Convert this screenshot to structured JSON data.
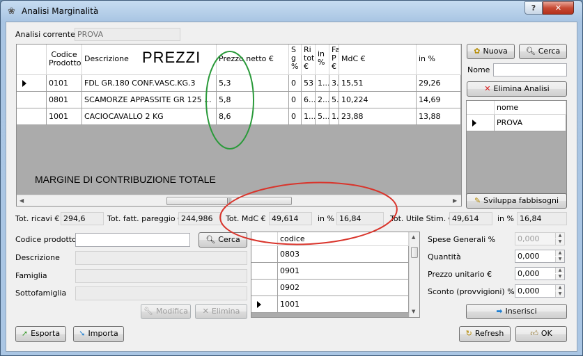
{
  "window": {
    "title": "Analisi Marginalità",
    "help_label": "?",
    "close_label": "✕"
  },
  "current": {
    "label": "Analisi corrente",
    "value": "PROVA"
  },
  "prices_grid": {
    "overlay_title": "PREZZI",
    "columns": [
      {
        "label": "Codice Prodotto"
      },
      {
        "label": "Descrizione"
      },
      {
        "label": "Prezzo netto €"
      },
      {
        "label": "S g %"
      },
      {
        "label": "Ri tot €"
      },
      {
        "label": "in %"
      },
      {
        "label": "Fa P €"
      },
      {
        "label": "MdC €"
      },
      {
        "label": "in %"
      }
    ],
    "rows": [
      {
        "cells": [
          "0101",
          "FDL GR.180 CONF.VASC.KG.3",
          "5,3",
          "0",
          "53",
          "1...",
          "3...",
          "15,51",
          "29,26"
        ]
      },
      {
        "cells": [
          "0801",
          "SCAMORZE APPASSITE GR 125 ...",
          "5,8",
          "0",
          "6...",
          "2...",
          "5...",
          "10,224",
          "14,69"
        ]
      },
      {
        "cells": [
          "1001",
          "CACIOCAVALLO 2 KG",
          "8,6",
          "0",
          "1...",
          "5...",
          "1...",
          "23,88",
          "13,88"
        ]
      }
    ],
    "margin_label": "MARGINE DI CONTRIBUZIONE TOTALE"
  },
  "right_panel": {
    "new_button": "Nuova",
    "search_button": "Cerca",
    "name_label": "Nome",
    "name_value": "",
    "delete_button": "Elimina Analisi",
    "list_header": "nome",
    "list_items": [
      "PROVA"
    ],
    "develop_button": "Sviluppa fabbisogni"
  },
  "totals": {
    "ricavi_label": "Tot. ricavi €",
    "ricavi": "294,6",
    "pareggio_label": "Tot. fatt. pareggio €",
    "pareggio": "244,986",
    "mdc_label": "Tot. MdC €",
    "mdc": "49,614",
    "mdc_pct_label": "in %",
    "mdc_pct": "16,84",
    "utile_label": "Tot. Utile Stim. €",
    "utile": "49,614",
    "utile_pct_label": "in %",
    "utile_pct": "16,84"
  },
  "product_form": {
    "code_label": "Codice prodotto",
    "code_value": "",
    "search_button": "Cerca",
    "desc_label": "Descrizione",
    "family_label": "Famiglia",
    "subfamily_label": "Sottofamiglia",
    "modify_button": "Modifica",
    "delete_button": "Elimina"
  },
  "code_grid": {
    "header": "codice",
    "items": [
      "0803",
      "0901",
      "0902",
      "1001"
    ]
  },
  "params": {
    "spese_label": "Spese Generali %",
    "spese": "0,000",
    "quantita_label": "Quantità",
    "quantita": "0,000",
    "prezzo_label": "Prezzo unitario €",
    "prezzo": "0,000",
    "sconto_label": "Sconto (provvigioni) %",
    "sconto": "0,000",
    "insert_button": "Inserisci"
  },
  "footer": {
    "export_button": "Esporta",
    "import_button": "Importa",
    "refresh_button": "Refresh",
    "ok_button": "OK"
  },
  "colors": {
    "green_ellipse": "#2a9a3a",
    "red_ellipse": "#d9342b",
    "delete_icon": "#d81b1b",
    "insert_arrow": "#1f7fd1"
  }
}
